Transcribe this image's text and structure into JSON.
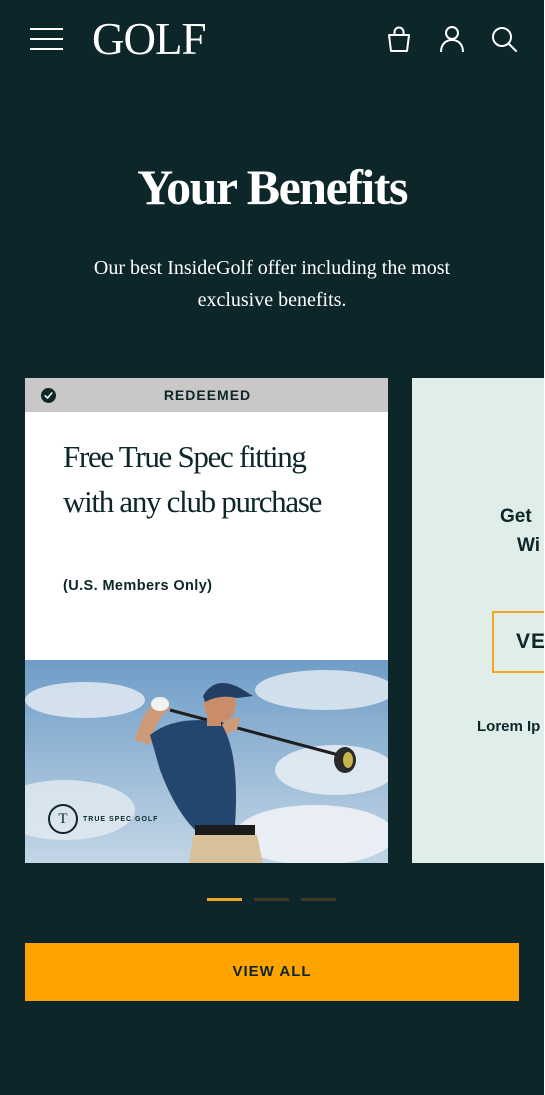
{
  "header": {
    "logo": "GOLF",
    "icons": [
      "menu-icon",
      "shopping-bag-icon",
      "user-icon",
      "search-icon"
    ]
  },
  "hero": {
    "title": "Your Benefits",
    "subtitle": "Our best InsideGolf offer including the most exclusive benefits."
  },
  "benefits": {
    "cards": [
      {
        "status": "REDEEMED",
        "title": "Free True Spec fitting with any club purchase",
        "note": "(U.S. Members Only)",
        "brand": "TRUE SPEC GOLF",
        "brand_mark": "T"
      },
      {
        "line1": "Get",
        "line2": "Wi",
        "button_label": "VE",
        "footnote": "Lorem Ip"
      }
    ],
    "pagination": {
      "count": 3,
      "active": 0
    }
  },
  "cta": {
    "view_all_label": "VIEW ALL"
  },
  "colors": {
    "background": "#0c2629",
    "accent": "#ffa300",
    "card_alt": "#dfeee9",
    "redeemed_bar": "#c9c7c8"
  }
}
